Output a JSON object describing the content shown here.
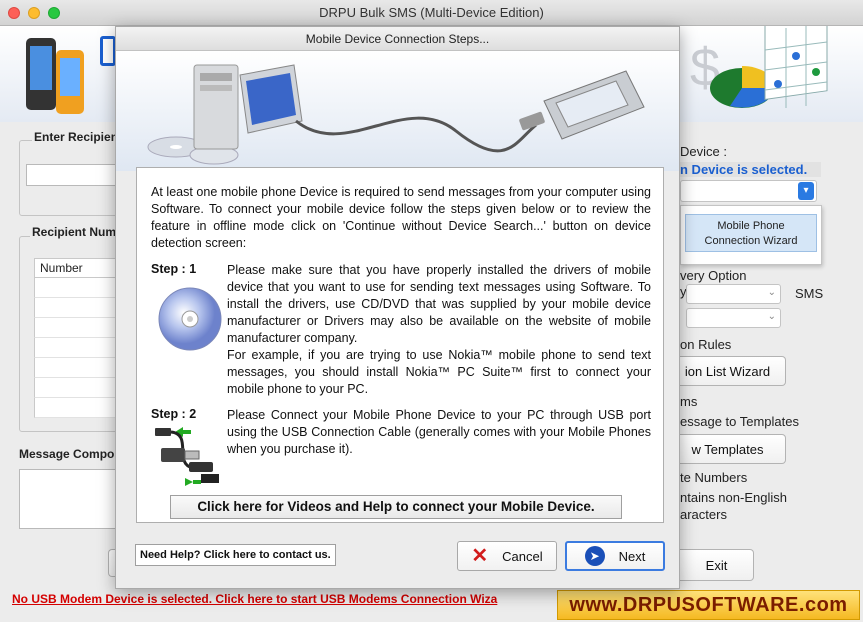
{
  "window": {
    "title": "DRPU Bulk SMS (Multi-Device Edition)"
  },
  "left_panel": {
    "enter_recipient_label": "Enter Recipient",
    "recipient_number_label": "Recipient Numb",
    "number_column": "Number",
    "message_composer_label": "Message Compo"
  },
  "right_panel": {
    "device_label": "Device :",
    "device_status": "n Device is selected.",
    "wizard_button_line1": "Mobile Phone",
    "wizard_button_line2": "Connection  Wizard",
    "delivery_option": "very Option",
    "sms_label": "SMS",
    "exclusion_rules": "on Rules",
    "exclusion_wizard_button": "ion List Wizard",
    "items_label": "ms",
    "save_template": "essage to Templates",
    "view_templates_button": "w Templates",
    "duplicate_numbers": "te Numbers",
    "non_english_line1": "ntains non-English",
    "non_english_line2": "aracters",
    "exit_button": "Exit"
  },
  "status": {
    "modem_link": "No USB Modem Device is selected. Click here to start USB Modems Connection Wiza"
  },
  "brand": {
    "text": "www.DRPUSOFTWARE.com"
  },
  "dialog": {
    "title": "Mobile Device Connection Steps...",
    "intro": "At least one mobile phone Device is required to send messages from your computer using Software.  To connect your mobile device follow the steps given below or to review the feature in offline mode click on 'Continue without Device Search...' button on device detection screen:",
    "step1_label": "Step : 1",
    "step1_text": "Please make sure that you have properly installed the drivers of mobile device that you want to use for sending text messages using Software. To install the drivers, use CD/DVD that was supplied by your mobile device manufacturer or Drivers may also be available on the website of mobile manufacturer company.",
    "step1_example": "For example, if you are trying to use Nokia™ mobile phone to send text messages, you should install Nokia™ PC Suite™ first to connect your mobile phone to your PC.",
    "step2_label": "Step : 2",
    "step2_text": "Please Connect your Mobile Phone Device to your PC through USB port using the USB Connection Cable (generally comes with your Mobile Phones when you purchase it).",
    "help_videos_button": "Click here for Videos and Help to connect your Mobile Device.",
    "contact_button": "Need Help? Click here to contact us.",
    "cancel_button": "Cancel",
    "next_button": "Next"
  },
  "colors": {
    "accent": "#1a5fd0",
    "status_red": "#d40000",
    "brand_bg": "#f5b922",
    "next_border": "#3b7be0"
  }
}
